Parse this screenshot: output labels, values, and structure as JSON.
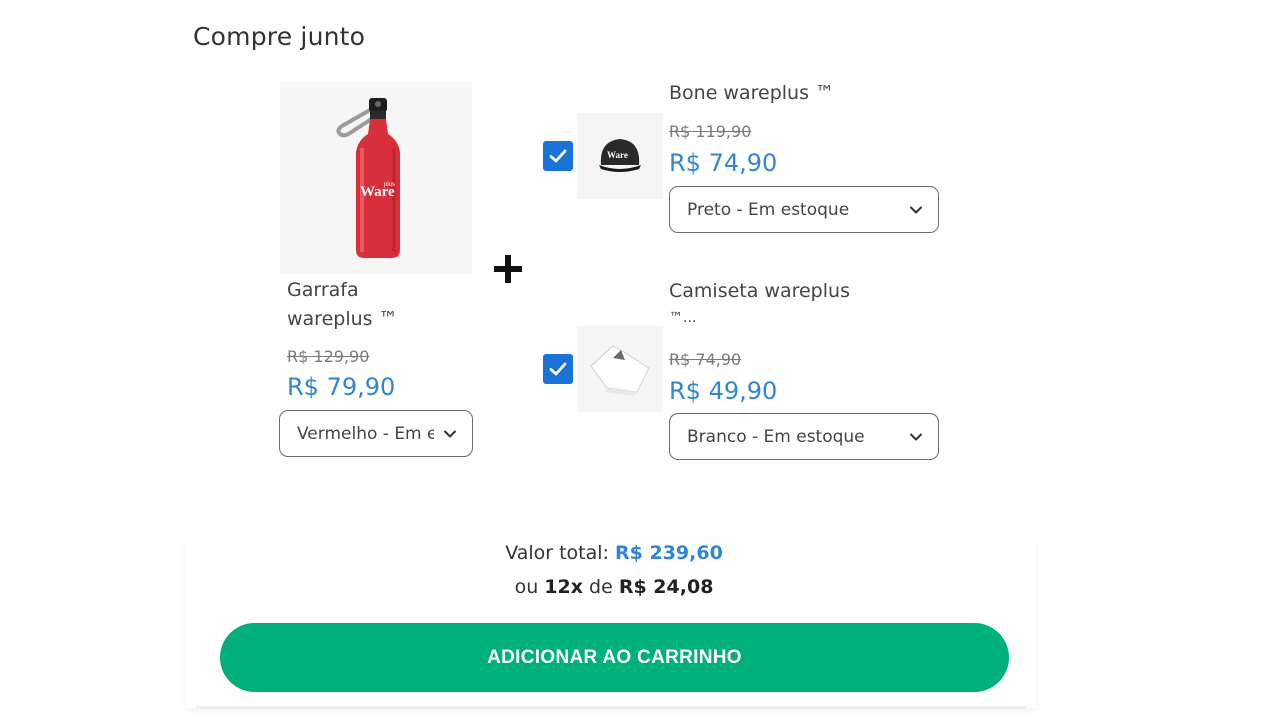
{
  "section": {
    "title": "Compre junto"
  },
  "main_product": {
    "name_line1": "Garrafa",
    "name_line2": "wareplus ™",
    "old_price": "R$ 129,90",
    "price": "R$ 79,90",
    "variant": "Vermelho - Em estoque",
    "image_icon": "red-bottle-image",
    "color": "#d8303a"
  },
  "items": [
    {
      "name": "Bone wareplus ™",
      "old_price": "R$ 119,90",
      "price": "R$ 74,90",
      "variant": "Preto - Em estoque",
      "checked": true,
      "image_icon": "black-cap-image"
    },
    {
      "name_line1": "Camiseta wareplus",
      "name_line2": "™...",
      "old_price": "R$ 74,90",
      "price": "R$ 49,90",
      "variant": "Branco - Em estoque",
      "checked": true,
      "image_icon": "white-tshirt-image"
    }
  ],
  "summary": {
    "total_label": "Valor total:",
    "total_value": "R$ 239,60",
    "installments_prefix": "ou",
    "installments_count": "12x",
    "installments_mid": "de",
    "installments_value": "R$ 24,08"
  },
  "cart_button": {
    "label": "ADICIONAR AO CARRINHO"
  },
  "colors": {
    "accent_price": "#2f86d4",
    "button": "#00b07a",
    "checkbox": "#1a73d9"
  }
}
